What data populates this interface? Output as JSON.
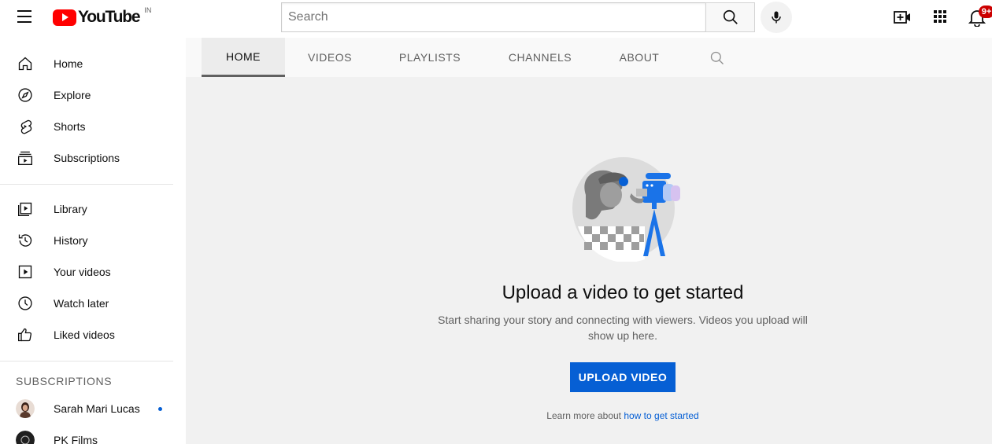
{
  "masthead": {
    "logo_text": "YouTube",
    "country_code": "IN",
    "search_placeholder": "Search",
    "notification_count": "9+"
  },
  "sidebar": {
    "main_items": [
      {
        "label": "Home",
        "icon": "home-icon"
      },
      {
        "label": "Explore",
        "icon": "compass-icon"
      },
      {
        "label": "Shorts",
        "icon": "shorts-icon"
      },
      {
        "label": "Subscriptions",
        "icon": "subscriptions-icon"
      }
    ],
    "library_items": [
      {
        "label": "Library",
        "icon": "library-icon"
      },
      {
        "label": "History",
        "icon": "history-icon"
      },
      {
        "label": "Your videos",
        "icon": "your-videos-icon"
      },
      {
        "label": "Watch later",
        "icon": "clock-icon"
      },
      {
        "label": "Liked videos",
        "icon": "thumbs-up-icon"
      }
    ],
    "subscriptions_title": "SUBSCRIPTIONS",
    "subscriptions": [
      {
        "name": "Sarah Mari Lucas",
        "has_new": true
      },
      {
        "name": "PK Films",
        "has_new": false
      }
    ]
  },
  "channel_tabs": [
    "HOME",
    "VIDEOS",
    "PLAYLISTS",
    "CHANNELS",
    "ABOUT"
  ],
  "empty_state": {
    "title": "Upload a video to get started",
    "description": "Start sharing your story and connecting with viewers. Videos you upload will show up here.",
    "button_label": "UPLOAD VIDEO",
    "learn_more_prefix": "Learn more about ",
    "learn_more_link": "how to get started"
  },
  "colors": {
    "brand_red": "#ff0000",
    "accent_blue": "#065fd4",
    "badge_red": "#cc0000"
  }
}
